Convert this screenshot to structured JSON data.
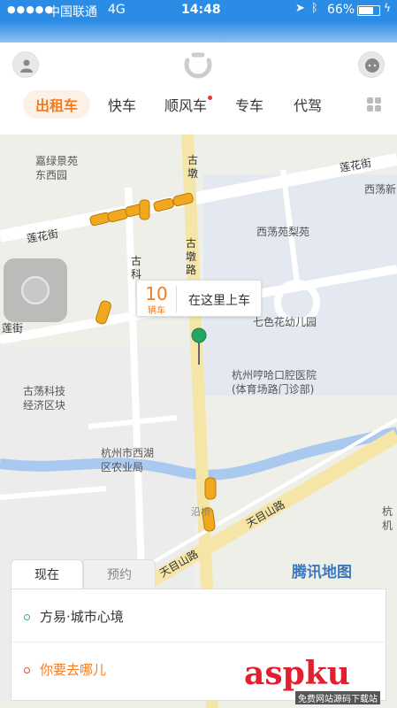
{
  "status_bar": {
    "signal": "●●●●●",
    "carrier": "中国联通",
    "network": "4G",
    "time": "14:48",
    "battery": "66%"
  },
  "header": {
    "tabs": [
      {
        "label": "出租车",
        "active": true
      },
      {
        "label": "快车"
      },
      {
        "label": "顺风车",
        "badge_dot": true
      },
      {
        "label": "专车"
      },
      {
        "label": "代驾"
      }
    ]
  },
  "map": {
    "pois": [
      "嘉绿景苑\n东西园",
      "西荡苑梨苑",
      "西荡新",
      "七色花幼儿园",
      "杭州哼哈口腔医院\n(体育场路门诊部)",
      "古荡科技\n经济区块",
      "杭州市西湖\n区农业局",
      "杭\n机"
    ],
    "roads": [
      "莲花街",
      "莲花街",
      "莲街",
      "古墩",
      "古墩路",
      "古科",
      "天目山路",
      "天目山路",
      "沿桥"
    ],
    "callout": {
      "count": "10",
      "unit": "辆车",
      "text": "在这里上车"
    },
    "provider": "腾讯地图"
  },
  "panel": {
    "tabs": [
      "现在",
      "预约"
    ],
    "origin": "方易·城市心境",
    "destination_placeholder": "你要去哪儿"
  },
  "watermark": {
    "text": "aspku",
    "sub": "免费网站源码下载站"
  },
  "colors": {
    "accent": "#f47c20",
    "status_blue": "#2b8ce6",
    "road_yellow": "#f5e6a8",
    "origin_green": "#3bb36b",
    "dest_red": "#e8453c"
  },
  "icons": [
    "user-icon",
    "didi-logo",
    "message-icon",
    "grid-icon",
    "location-icon",
    "pin-icon",
    "taxi-icon"
  ]
}
